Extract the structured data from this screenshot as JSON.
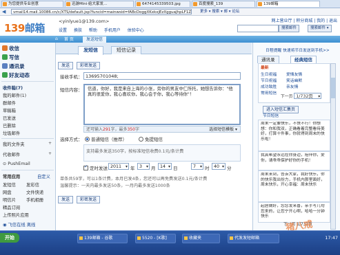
{
  "browser": {
    "tabs": [
      "为您提供专业创意",
      "迅游Mini·给大家发...",
      "6474145339503.jpg",
      "百度搜索_139",
      "139邮箱"
    ],
    "address": "vmail14.mail.10086.cn/c/XTS/default.jsp?funcid=mainwsid=fABcDoggXKxkxjEzXgguaJhpLF1Zfh8",
    "address_links": "更多 ▾  搜索 ▾  邮 ▾  论坛"
  },
  "header": {
    "logo_num": "139",
    "logo_txt": "邮箱",
    "user": "<yinlyue1@139.com>",
    "subnav": [
      "设置",
      "换肤",
      "帮助",
      "手机用户",
      "体验中心"
    ],
    "top_links": "网上营业厅 | 积分商城 | 我的 | 退出",
    "search_button": "搜索邮件",
    "search_scope": "搜索邮件 ▾"
  },
  "tabbar": {
    "home": "首 页",
    "active": "发送短信"
  },
  "sidebar": {
    "inbox": "收信",
    "compose": "写信",
    "contacts": "通讯录",
    "friends": "好友动态",
    "folders_title": "收件箱(7)",
    "folders": [
      "我的邮件(1)",
      "群邮件",
      "草稿箱",
      "已发送",
      "已删除",
      "垃圾邮件"
    ],
    "my_folders": "我的文件夹",
    "proxy": "代收邮件",
    "pushemail": "PushEmail",
    "apps_title": "常用应用",
    "app_custom": "自定义",
    "apps": [
      "发短信",
      "发彩信",
      "网盘",
      "文件快递",
      "明信片",
      "手机相册",
      "精品订阅",
      "上传照片应用"
    ],
    "chat_label": "飞信在线",
    "chat_mode": "离线",
    "chat_tray": "飞信客户端"
  },
  "main": {
    "tab_send": "发短信",
    "tab_record": "短信记录",
    "link_records": "日程提醒",
    "link_quick": "快速将节日发送到手机>>",
    "btn_send": "发送",
    "btn_send_later": "彩密发送",
    "label_recipient": "接收手机：",
    "recipient_value": "13695701048;",
    "label_content": "短信内容：",
    "content_text": "信道，你好，我是来自上海的小张，旁你的男友中仁所托，她想告诉你：\"他真的很爱你，我心喜欢你，我心会于你，我心等待你\"！",
    "count_line_a": "还可输入",
    "count_remaining": "291",
    "count_line_b": "字，最多",
    "count_max": "350",
    "count_line_c": "字",
    "choose_template": "选择短信模板 ▾",
    "label_method": "选择方式：",
    "method_normal": "普通短信（推荐）",
    "method_free": "免提短信",
    "notice_line1": "支持最多发送350字，按标准短信收费0.1元/条计费",
    "notice_line2": "",
    "schedule_label": "定时发送",
    "year": "2011",
    "year_unit": "年",
    "month": "3",
    "month_unit": "月",
    "day": "14",
    "day_unit": "日",
    "hour": "7",
    "hour_unit": "时",
    "minute": "40",
    "minute_unit": "分",
    "footer1": "单条共59字，可以1条计费，本月已发4条，您还可以再免费发送0.1元/条计费",
    "footer2": "温馨提示：一天内最多发送50条，一月内最多发送1000条",
    "bottom_send": "发送",
    "bottom_send_later": "彩密发送"
  },
  "right": {
    "links": "日程提醒  快速将节日发送到手机>>",
    "tab_contacts": "通讯录",
    "tab_classics": "经典短信",
    "categories_title": "最新",
    "categories": [
      "生日祝福",
      "爱情友情",
      "节日祝福",
      "笑话幽默",
      "成功致胜",
      "亲友情",
      "常用短信"
    ],
    "pager": "1/732页",
    "pager_prev": "下一页",
    "list_title": "进入短信汇集页",
    "list_label": "节日短信",
    "messages": [
      "周末一定要快乐，不快不行！你想想：你和我双，正确看着完整看待美好，打算十件事，你就得到周末的快乐啦！",
      "我真希望永远在你身边，陪伴你，爱你，请乖乖保护好你的手机！",
      "周末来到，告诉大家，我好快乐，你的快乐我出份力，手机内那里面好，周末快乐，开心幸福：周末快乐",
      "起居做好，您您发来喜，亲手写几句您来的，让您宁开心啊，哈哈一分钟快乐"
    ],
    "pager_bottom": "1/732页"
  },
  "taskbar": {
    "start": "开始",
    "items": [
      "139邮箱 - 谷歌",
      "5520 - [K歌]",
      "收藏夹",
      "代发发短邮箱"
    ],
    "clock": "17:47"
  },
  "watermark": "猪八戒"
}
